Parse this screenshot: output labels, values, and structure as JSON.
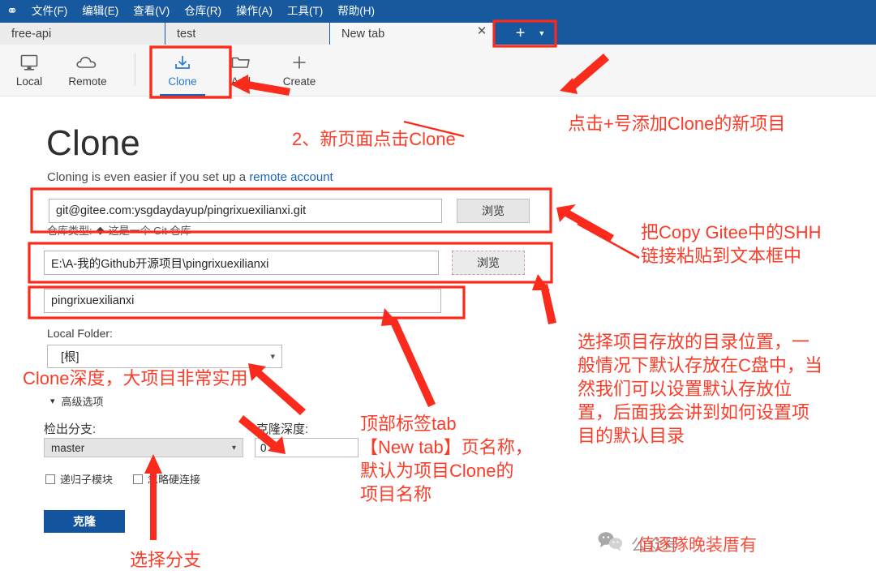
{
  "window": {
    "logo_icon": "sourcetree-logo-icon",
    "menus": [
      {
        "label": "文件(F)"
      },
      {
        "label": "编辑(E)"
      },
      {
        "label": "查看(V)"
      },
      {
        "label": "仓库(R)"
      },
      {
        "label": "操作(A)"
      },
      {
        "label": "工具(T)"
      },
      {
        "label": "帮助(H)"
      }
    ]
  },
  "tabs": {
    "items": [
      {
        "label": "free-api",
        "active": false,
        "closable": false
      },
      {
        "label": "test",
        "active": false,
        "closable": false
      },
      {
        "label": "New tab",
        "active": true,
        "closable": true,
        "close_icon": "close-icon"
      }
    ],
    "new_tab_icon": "plus-icon",
    "new_tab_caret_icon": "chevron-down-icon"
  },
  "toolbar": {
    "items": [
      {
        "label": "Local",
        "icon": "monitor-icon",
        "active": false
      },
      {
        "label": "Remote",
        "icon": "cloud-icon",
        "active": false
      },
      {
        "label": "Clone",
        "icon": "download-icon",
        "active": true
      },
      {
        "label": "Add",
        "icon": "folder-icon",
        "active": false
      },
      {
        "label": "Create",
        "icon": "plus-icon",
        "active": false
      }
    ]
  },
  "form": {
    "title": "Clone",
    "subtitle_prefix": "Cloning is even easier if you set up a ",
    "subtitle_link": "remote account",
    "source_url": {
      "value": "git@gitee.com:ysgdaydayup/pingrixuexilianxi.git",
      "placeholder": "",
      "browse_label": "浏览"
    },
    "repo_type": {
      "label": "仓库类型:",
      "marker_icon": "diamond-icon",
      "value": "这是一个 Git 仓库"
    },
    "destination_path": {
      "value": "E:\\A-我的Github开源项目\\pingrixuexilianxi",
      "placeholder": "",
      "browse_label": "浏览"
    },
    "name": {
      "value": "pingrixuexilianxi",
      "placeholder": ""
    },
    "local_folder": {
      "label": "Local Folder:",
      "value": "[根]",
      "chevron_icon": "chevron-down-icon"
    },
    "advanced_options": {
      "label": "高级选项",
      "chevron_icon": "chevron-down-icon"
    },
    "checkout_branch": {
      "label": "检出分支:",
      "value": "master",
      "chevron_icon": "chevron-down-icon"
    },
    "clone_depth": {
      "label": "克隆深度:",
      "value": "0"
    },
    "checkboxes": [
      {
        "label": "递归子模块",
        "checked": false
      },
      {
        "label": "忽略硬连接",
        "checked": false
      }
    ],
    "submit_label": "克隆"
  },
  "annotations": {
    "clone_tab": "2、新页面点击Clone",
    "plus_button": "点击+号添加Clone的新项目",
    "ssh_paste": "把Copy Gitee中的SHH\n链接粘贴到文本框中",
    "directory": "选择项目存放的目录位置，一\n般情况下默认存放在C盘中，当\n然我们可以设置默认存放位\n置，后面我会讲到如何设置项\n目的默认目录",
    "tab_name": "顶部标签tab\n【New tab】页名称，\n默认为项目Clone的\n项目名称",
    "clone_depth": "Clone深度，大项目非常实用",
    "select_branch": "选择分支"
  },
  "watermark": {
    "icon": "wechat-icon",
    "text": "公众号",
    "overlay_text": "值逐隊晚装厝有"
  },
  "colors": {
    "titlebar_blue": "#17599f",
    "accent_blue": "#2a7ad4",
    "annotation_red": "#fa3c28",
    "button_blue": "#12559e",
    "link_blue": "#1a63c2"
  }
}
